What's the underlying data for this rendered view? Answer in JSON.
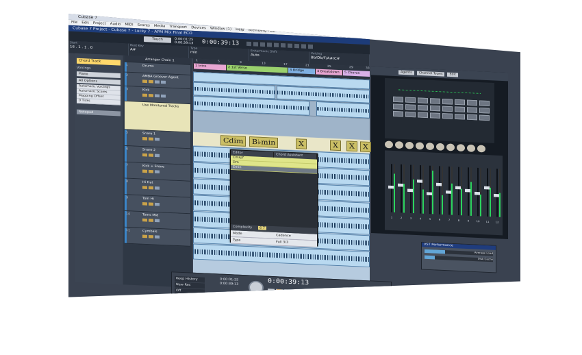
{
  "window": {
    "title": "Cubase 7",
    "project_title": "Cubase 7 Project - Cubase 7 - Lucky 7 - APM Mix Final ECO"
  },
  "menu": [
    "File",
    "Edit",
    "Project",
    "Audio",
    "MIDI",
    "Scores",
    "Media",
    "Transport",
    "Devices",
    "Window (1)",
    "Help",
    "Steinberg Hub"
  ],
  "toolbar": {
    "touch_label": "Touch",
    "time_top": "0:00:01:25",
    "time_bottom": "0:00:39:13",
    "main_time": "0:00:39:13"
  },
  "info_line": [
    {
      "label": "Start",
      "value": "16 . 1 . 1 . 0"
    },
    {
      "label": "Root Key",
      "value": "A#"
    },
    {
      "label": "Type",
      "value": "min"
    },
    {
      "label": "Enharmonic Shift",
      "value": "Auto"
    },
    {
      "label": "Voicing",
      "value": "Bb/Db/F/A#/C#"
    }
  ],
  "inspector": {
    "head": "Chord Track",
    "voicings_label": "Voicings",
    "voicing_value": "Piano",
    "options_value": "All Options",
    "list": [
      "Automatic Voicings",
      "Automatic Scales",
      "Mapping Offset"
    ],
    "offset_value": "0 Ticks",
    "bottom_label": "Notepad"
  },
  "tracks": [
    {
      "num": "1",
      "name": "Drums"
    },
    {
      "num": "2",
      "name": "AMBA Groover Agent"
    },
    {
      "num": "3",
      "name": "Kick"
    },
    {
      "num": "4",
      "name": "Use Monitored Tracks"
    },
    {
      "num": "5",
      "name": "Snare 1"
    },
    {
      "num": "6",
      "name": "Snare 2"
    },
    {
      "num": "7",
      "name": "Kick + Snare"
    },
    {
      "num": "8",
      "name": "Hi Hat"
    },
    {
      "num": "9",
      "name": "Tom Hi"
    },
    {
      "num": "10",
      "name": "Toms Mid"
    },
    {
      "num": "11",
      "name": "Cymbals"
    }
  ],
  "arranger_chain": "Arranger Chain 1",
  "arranger_parts": [
    "1 Intro",
    "2 1st Verse",
    "3 Bridge",
    "4 Breakdown",
    "5 Chorus"
  ],
  "ruler_marks": [
    "1",
    "5",
    "9",
    "13",
    "17",
    "21",
    "25",
    "29",
    "33"
  ],
  "chords": [
    "Cdim",
    "B♭min",
    "X",
    "X",
    "X",
    "X"
  ],
  "chord_editor": {
    "tab1": "Editor",
    "tab2": "Chord Assistant",
    "items": [
      "Cmaj7",
      "Dm",
      "Emin"
    ],
    "complexity_label": "Complexity",
    "complexity_value": "6 7",
    "mode_label": "Mode",
    "mode_value": "Cadence",
    "type_label": "Type",
    "type_value": "Full 3/3"
  },
  "right_panel": {
    "buttons": [
      "Agents",
      "Channel Types",
      "Edit"
    ],
    "mixer_labels": [
      "1",
      "2",
      "3",
      "4",
      "5",
      "6",
      "7",
      "8",
      "9",
      "10",
      "11",
      "12"
    ],
    "fader_levels": [
      0.55,
      0.6,
      0.5,
      0.7,
      0.45,
      0.65,
      0.5,
      0.6,
      0.55,
      0.5,
      0.62,
      0.48
    ],
    "meter_levels": [
      0.8,
      0.6,
      0.7,
      0.5,
      0.9,
      0.4,
      0.65,
      0.55,
      0.7,
      0.45,
      0.6,
      0.5
    ]
  },
  "transport": {
    "history": [
      "Keep History",
      "New Rec",
      "Off"
    ],
    "time_small_1": "0:00:01:25",
    "time_small_2": "0:00:39:13",
    "main_time": "0:00:39:13"
  },
  "vst_performance": {
    "title": "VST Performance",
    "average_label": "Average Load",
    "disk_label": "Disk Cache",
    "average_load": 0.3,
    "disk_cache": 0.15
  },
  "colors": {
    "track_blue": "#3b86c9",
    "chord_yellow": "#cbbf65",
    "arranger_pink": "#e7a5d1",
    "arranger_green": "#9ad16d",
    "arranger_blue": "#7fb0e2"
  }
}
